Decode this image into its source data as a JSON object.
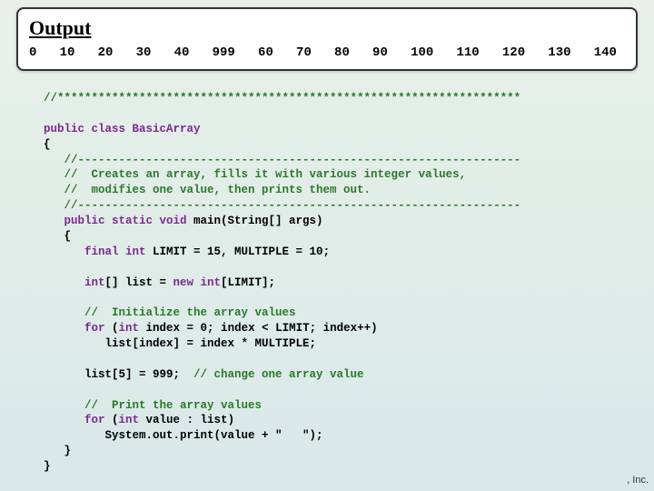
{
  "output": {
    "title": "Output",
    "values": "0   10   20   30   40   999   60   70   80   90   100   110   120   130   140"
  },
  "code": {
    "l1": "//********************************************************************",
    "l2": "",
    "l3": "public class BasicArray",
    "l4": "{",
    "l5": "   //-----------------------------------------------------------------",
    "l6": "   //  Creates an array, fills it with various integer values,",
    "l7": "   //  modifies one value, then prints them out.",
    "l8": "   //-----------------------------------------------------------------",
    "l9a": "   public static void",
    "l9b": " main(String[] args)",
    "l10": "   {",
    "l11a": "      final int",
    "l11b": " LIMIT = 15, MULTIPLE = 10;",
    "l12": "",
    "l13a": "      int",
    "l13b": "[] list = ",
    "l13c": "new int",
    "l13d": "[LIMIT];",
    "l14": "",
    "l15": "      //  Initialize the array values",
    "l16a": "      for",
    "l16b": " (",
    "l16c": "int",
    "l16d": " index = 0; index < LIMIT; index++)",
    "l17": "         list[index] = index * MULTIPLE;",
    "l18": "",
    "l19a": "      list[5] = 999;  ",
    "l19b": "// change one array value",
    "l20": "",
    "l21": "      //  Print the array values",
    "l22a": "      for",
    "l22b": " (",
    "l22c": "int",
    "l22d": " value : list)",
    "l23": "         System.out.print(value + \"   \");",
    "l24": "   }",
    "l25": "}"
  },
  "copyright": ", Inc."
}
